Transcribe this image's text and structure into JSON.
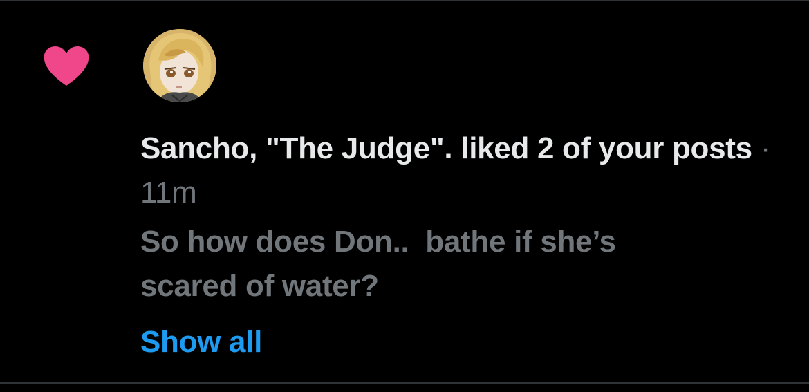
{
  "notification": {
    "type_icon": "heart-icon",
    "icon_color": "#f91880",
    "avatar": "user-avatar",
    "user_name": "Sancho, \"The Judge\".",
    "action_text": " liked 2 of your posts",
    "separator": " · ",
    "time_ago": "11m",
    "post_snippet_line1": "So how does Don..  bathe if she’s",
    "post_snippet_line2": "scared of water?",
    "show_all_label": "Show all"
  },
  "colors": {
    "background": "#000000",
    "text_primary": "#e7e9ea",
    "text_secondary": "#71767b",
    "link": "#1d9bf0",
    "like": "#f91880"
  }
}
